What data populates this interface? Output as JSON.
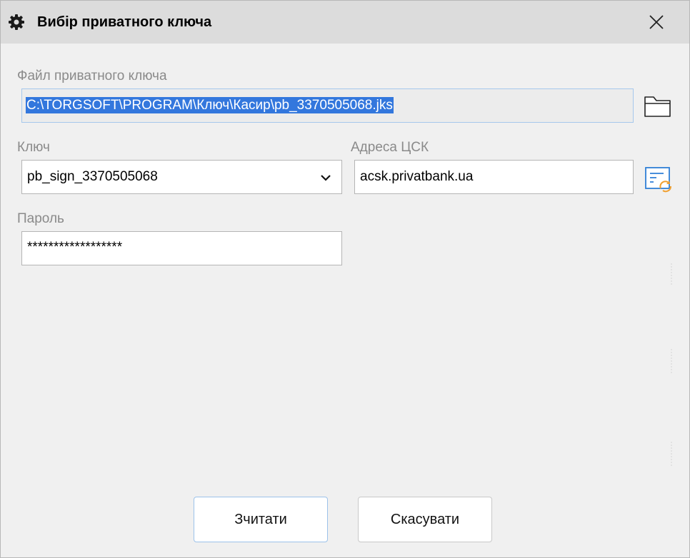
{
  "window": {
    "title": "Вибір приватного ключа",
    "close_label": "✕"
  },
  "form": {
    "key_file": {
      "label": "Файл приватного ключа",
      "value": "C:\\TORGSOFT\\PROGRAM\\Ключ\\Касир\\pb_3370505068.jks"
    },
    "key": {
      "label": "Ключ",
      "selected": "pb_sign_3370505068"
    },
    "csk_address": {
      "label": "Адреса ЦСК",
      "value": "acsk.privatbank.ua"
    },
    "password": {
      "label": "Пароль",
      "masked_value": "******************"
    }
  },
  "buttons": {
    "read_label": "Зчитати",
    "cancel_label": "Скасувати"
  },
  "colors": {
    "titlebar": "#dcdcdc",
    "selection": "#3377dd",
    "accent_blue": "#2f7fd6",
    "accent_orange": "#f0a030"
  },
  "icons": {
    "title": "gear-icon",
    "close": "close-icon",
    "browse": "folder-icon",
    "dropdown": "chevron-down-icon",
    "csk": "server-list-refresh-icon"
  }
}
